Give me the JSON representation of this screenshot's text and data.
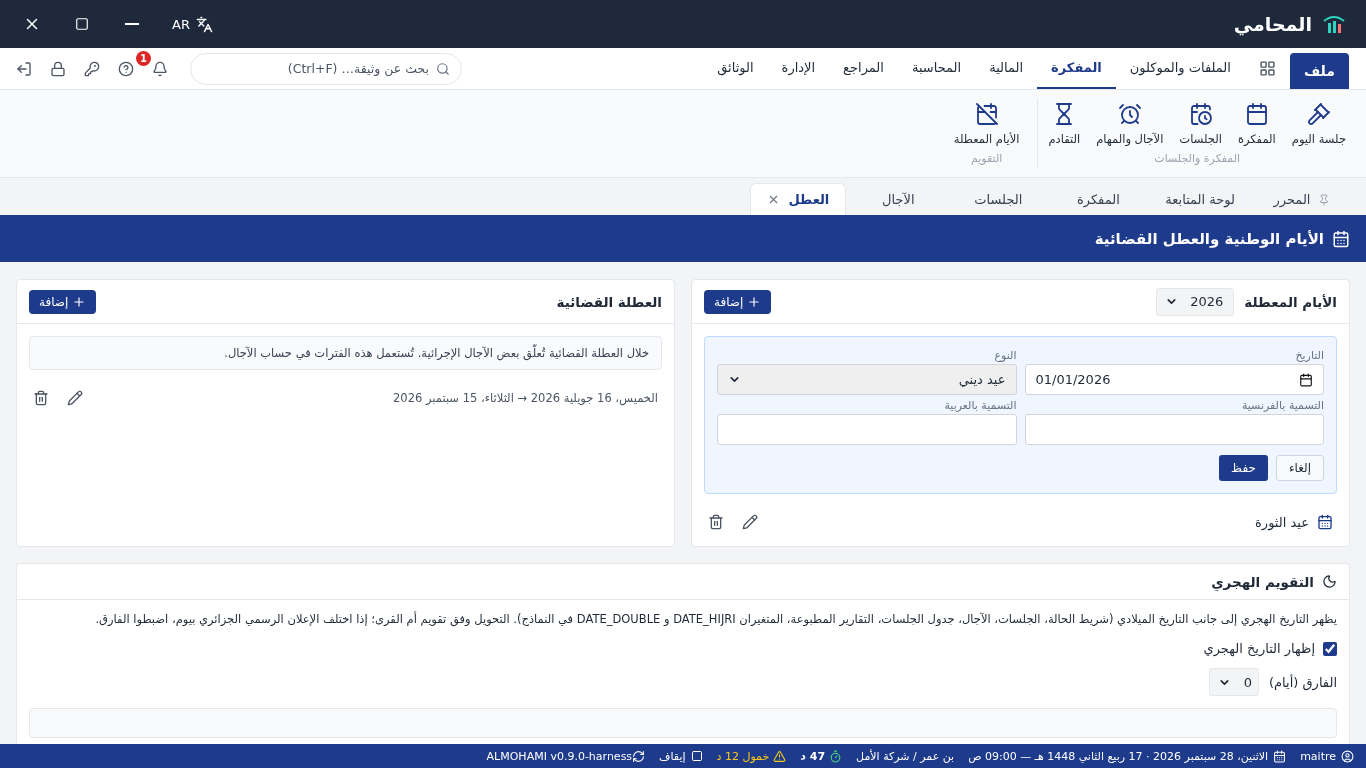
{
  "titlebar": {
    "app_name": "المحامي",
    "language": "AR"
  },
  "menu": {
    "file_button": "ملف",
    "tabs": [
      {
        "label": "الملفات والموكلون",
        "selected": false
      },
      {
        "label": "المفكرة",
        "selected": true
      },
      {
        "label": "المالية",
        "selected": false
      },
      {
        "label": "المحاسبة",
        "selected": false
      },
      {
        "label": "المراجع",
        "selected": false
      },
      {
        "label": "الإدارة",
        "selected": false
      },
      {
        "label": "الوثائق",
        "selected": false
      }
    ],
    "search": {
      "placeholder": "بحث عن وثيقة… (Ctrl+F)"
    },
    "notification_count": "1"
  },
  "ribbon": {
    "groups": [
      {
        "label": "المفكرة والجلسات",
        "items": [
          {
            "kind": "gavel",
            "label": "جلسة اليوم"
          },
          {
            "kind": "calendar",
            "label": "المفكرة"
          },
          {
            "kind": "calendar-clock",
            "label": "الجلسات"
          },
          {
            "kind": "alarm",
            "label": "الآجال والمهام"
          },
          {
            "kind": "hourglass",
            "label": "التقادم"
          }
        ]
      },
      {
        "label": "التقويم",
        "items": [
          {
            "kind": "calendar-off",
            "label": "الأيام المعطلة"
          }
        ]
      }
    ]
  },
  "doc_tabs": [
    {
      "kind": "pinned",
      "label": "المحرر",
      "selected": false
    },
    {
      "kind": "plain",
      "label": "لوحة المتابعة",
      "selected": false
    },
    {
      "kind": "plain",
      "label": "المفكرة",
      "selected": false
    },
    {
      "kind": "plain",
      "label": "الجلسات",
      "selected": false
    },
    {
      "kind": "plain",
      "label": "الآجال",
      "selected": false
    },
    {
      "kind": "closable",
      "label": "العطل",
      "selected": true
    }
  ],
  "page_title": "الأيام الوطنية والعطل القضائية",
  "holidays": {
    "title": "الأيام المعطلة",
    "year": "2026",
    "add_button": "إضافة",
    "form": {
      "date_label": "التاريخ",
      "date_value": "01/01/2026",
      "type_label": "النوع",
      "type_value": "عيد ديني",
      "french_label": "التسمية بالفرنسية",
      "arabic_label": "التسمية بالعربية",
      "cancel_button": "إلغاء",
      "save_button": "حفظ"
    },
    "items": [
      {
        "name": "عيد الثورة"
      }
    ]
  },
  "recess": {
    "title": "العطلة القضائية",
    "add_button": "إضافة",
    "note": "خلال العطلة القضائية تُعلّق بعض الآجال الإجرائية. تُستعمل هذه الفترات في حساب الآجال.",
    "items": [
      {
        "range": "الخميس، 16 جويلية 2026 → الثلاثاء، 15 سبتمبر 2026"
      }
    ]
  },
  "hijri": {
    "title": "التقويم الهجري",
    "description": "يظهر التاريخ الهجري إلى جانب التاريخ الميلادي (شريط الحالة، الجلسات، الآجال، جدول الجلسات، التقارير المطبوعة، المتغيران DATE_HIJRI و DATE_DOUBLE في النماذج). التحويل وفق تقويم أم القرى؛ إذا اختلف الإعلان الرسمي الجزائري بيوم، اضبطوا الفارق.",
    "show_label": "إظهار التاريخ الهجري",
    "show_checked": true,
    "offset_label": "الفارق (أيام)",
    "offset_value": "0"
  },
  "status_bar": {
    "user": "maitre",
    "datetime": "الاثنين، 28 سبتمبر 2026 · 17 ربيع الثاني 1448 هـ — 09:00 ص",
    "office": "بن عمر / شركة الأمل",
    "timer": "47 د",
    "idle": "خمول 12 د",
    "pause": "إيقاف",
    "version": "ALMOHAMI v0.9.0-harness"
  }
}
